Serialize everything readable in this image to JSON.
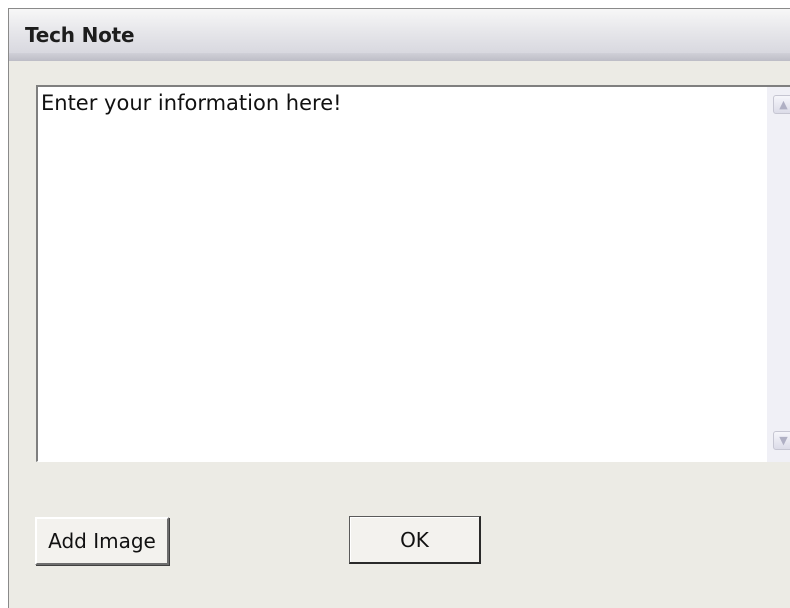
{
  "window": {
    "title": "Tech Note"
  },
  "note": {
    "text": "Enter your information here!"
  },
  "buttons": {
    "add_image": "Add Image",
    "ok": "OK"
  },
  "icons": {
    "scroll_up": "scroll-up-arrow",
    "scroll_down": "scroll-down-arrow"
  },
  "colors": {
    "window_background": "#ecebe5",
    "titlebar_top": "#f7f7f7",
    "titlebar_bottom": "#d4d4dc",
    "text_area_background": "#ffffff"
  }
}
